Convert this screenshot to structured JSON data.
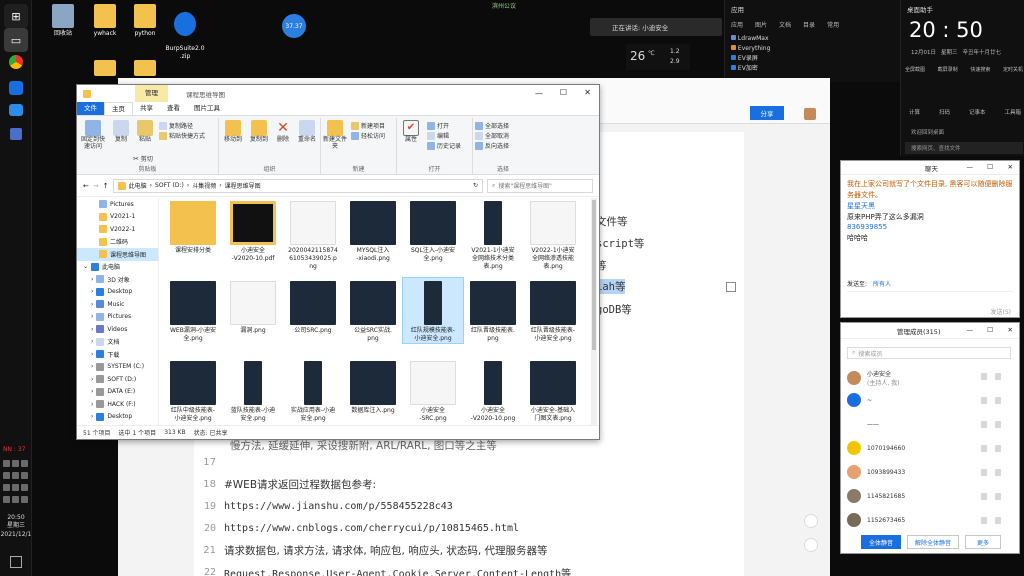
{
  "desktop": {
    "icons": [
      {
        "label": "回收站"
      },
      {
        "label": "ywhack"
      },
      {
        "label": "python"
      },
      {
        "label": "BurpSuite2.0\n.zip"
      }
    ],
    "badge_fps": "37.37"
  },
  "top_center": {
    "signal": "滨州公议"
  },
  "live": {
    "text": "正在讲话: 小迪安全"
  },
  "net_widget": {
    "temp": "26",
    "unit": "℃",
    "up": "1.2",
    "down": "2.9"
  },
  "apps_panel": {
    "title": "应用",
    "tabs": [
      "应用",
      "图片",
      "文档",
      "目录",
      "常用"
    ],
    "items": [
      "LdrawMax",
      "Everything",
      "EV录屏",
      "EV加密"
    ]
  },
  "clock": {
    "title": "桌面助手",
    "time": "20 : 50",
    "date": "12月01日",
    "weekday": "星期三",
    "lunar": "辛丑年十月廿七",
    "actions": [
      "全屏截图",
      "截屏录制",
      "快速搜索",
      "定时关机"
    ],
    "actions2": [
      "计算",
      "扫码",
      "记事本",
      "工具箱"
    ],
    "message": "欢迎回到桌面",
    "search_placeholder": "搜索网页、查找文件"
  },
  "editor": {
    "share_label": "分享",
    "lines": [
      {
        "n": "17",
        "text": ""
      },
      {
        "n": "18",
        "text": "#WEB请求返回过程数据包参考:"
      },
      {
        "n": "19",
        "text": "https://www.jianshu.com/p/558455228c43"
      },
      {
        "n": "20",
        "text": "https://www.cnblogs.com/cherrycui/p/10815465.html"
      },
      {
        "n": "21",
        "text": "请求数据包, 请求方法, 请求体, 响应包, 响应头, 状态码, 代理服务器等"
      },
      {
        "n": "22",
        "text": "Request,Response,User-Agent,Cookie,Server,Content-Length等"
      }
    ],
    "partials": [
      "文件等",
      "script等",
      "等",
      "iah等",
      "goDB等"
    ],
    "prev_line": "慢方法, 延缓延伸, 采设搜新附, ARL/RARL, 图口等之主等"
  },
  "explorer": {
    "title": "课程思维导图",
    "ribbon_tabs": [
      "文件",
      "主页",
      "共享",
      "查看",
      "图片工具"
    ],
    "context_tab": "管理",
    "ribbon": {
      "clipboard": {
        "pin": "固定到快速访问",
        "copy": "复制",
        "paste": "粘贴",
        "cut": "剪切",
        "copypath": "复制路径",
        "pasteshortcut": "粘贴快捷方式",
        "name": "剪贴板"
      },
      "organize": {
        "move": "移动到",
        "copyto": "复制到",
        "delete": "删除",
        "rename": "重命名",
        "name": "组织"
      },
      "new": {
        "folder": "新建文件夹",
        "item": "新建项目",
        "easy": "轻松访问",
        "name": "新建"
      },
      "open": {
        "props": "属性",
        "open": "打开",
        "edit": "编辑",
        "history": "历史记录",
        "name": "打开"
      },
      "select": {
        "all": "全部选择",
        "none": "全部取消",
        "invert": "反向选择",
        "name": "选择"
      }
    },
    "address": [
      "此电脑",
      "SOFT (D:)",
      "斗集视频",
      "课程思维导图"
    ],
    "search_placeholder": "搜索\"课程思维导图\"",
    "nav": [
      {
        "label": "Pictures",
        "sel": false
      },
      {
        "label": "V2021-1",
        "sel": false
      },
      {
        "label": "V2022-1",
        "sel": false
      },
      {
        "label": "二维码",
        "sel": false
      },
      {
        "label": "课程思维导图",
        "sel": true
      },
      {
        "label": "此电脑",
        "sel": false
      },
      {
        "label": "3D 对象",
        "sel": false
      },
      {
        "label": "Desktop",
        "sel": false
      },
      {
        "label": "Music",
        "sel": false
      },
      {
        "label": "Pictures",
        "sel": false
      },
      {
        "label": "Videos",
        "sel": false
      },
      {
        "label": "文档",
        "sel": false
      },
      {
        "label": "下载",
        "sel": false
      },
      {
        "label": "SYSTEM (C:)",
        "sel": false
      },
      {
        "label": "SOFT (D:)",
        "sel": false
      },
      {
        "label": "DATA (E:)",
        "sel": false
      },
      {
        "label": "HACK (F:)",
        "sel": false
      },
      {
        "label": "Desktop",
        "sel": false
      }
    ],
    "files": [
      {
        "name": "课程安排分类",
        "kind": "folder"
      },
      {
        "name": "小迪安全\n-V2020-10.pdf",
        "kind": "pdf"
      },
      {
        "name": "2020042115874\n61053439025.p\nng",
        "kind": "white"
      },
      {
        "name": "MYSQL注入\n-xiaodi.png",
        "kind": "dark"
      },
      {
        "name": "SQL注入-小迪安\n全.png",
        "kind": "dark"
      },
      {
        "name": "V2021-1小迪安\n全网络技术分类\n表.png",
        "kind": "tall"
      },
      {
        "name": "V2022-1小迪安\n全网络渗透技能\n表.png",
        "kind": "white"
      },
      {
        "name": "WEB漏洞-小迪安\n全.png",
        "kind": "dark"
      },
      {
        "name": "漏洞.png",
        "kind": "white"
      },
      {
        "name": "公司SRC.png",
        "kind": "dark"
      },
      {
        "name": "公益SRC实战.\npng",
        "kind": "dark"
      },
      {
        "name": "红队规模技能表-\n小迪安全.png",
        "kind": "tall",
        "sel": true
      },
      {
        "name": "红队晋级技能表.\npng",
        "kind": "dark"
      },
      {
        "name": "红队晋级技能表-\n小迪安全.png",
        "kind": "dark"
      },
      {
        "name": "红队中级技能表-\n小迪安全.png",
        "kind": "dark"
      },
      {
        "name": "蓝队技能表-小迪\n安全.png",
        "kind": "tall"
      },
      {
        "name": "实战应用表-小迪\n安全.png",
        "kind": "tall"
      },
      {
        "name": "数据库注入.png",
        "kind": "dark"
      },
      {
        "name": "小迪安全\n-SRC.png",
        "kind": "white"
      },
      {
        "name": "小迪安全\n-V2020-10.png",
        "kind": "tall"
      },
      {
        "name": "小迪安全-基础入\n门图文表.png",
        "kind": "dark"
      }
    ],
    "status": {
      "count": "51 个项目",
      "selected": "选中 1 个项目",
      "size": "313 KB",
      "state": "状态: 已共享"
    }
  },
  "chat": {
    "title": "聊天",
    "messages": [
      {
        "text": "我在上家公司就写了个文件目录, 黑客可以随便删除服务器文件。",
        "color": "#c85a00"
      },
      {
        "text": "星星天黑",
        "color": "#1a6fe0"
      },
      {
        "text": "原来PHP弄了这么多漏洞",
        "color": "#222"
      },
      {
        "text": "836939855",
        "color": "#1a6fe0"
      },
      {
        "text": "哈哈哈",
        "color": "#222"
      }
    ],
    "send_to_label": "发送至:",
    "send_to": "所有人",
    "send_hint": "发送(S)"
  },
  "members": {
    "title": "管理成员(315)",
    "search_placeholder": "搜索成员",
    "list": [
      {
        "name": "小迪安全",
        "sub": "(主持人, 我)",
        "color": "#c58a5a"
      },
      {
        "name": "~",
        "sub": "",
        "color": "#1a6fe0"
      },
      {
        "name": "——",
        "sub": "",
        "color": "#ffffff"
      },
      {
        "name": "1070194660",
        "sub": "",
        "color": "#f5c400"
      },
      {
        "name": "1093899433",
        "sub": "",
        "color": "#e8a070"
      },
      {
        "name": "1145821685",
        "sub": "",
        "color": "#8a7a6a"
      },
      {
        "name": "1152673465",
        "sub": "",
        "color": "#7a6a5a"
      }
    ],
    "btn_mute": "全体静音",
    "btn_unmute": "解除全体静音",
    "btn_more": "更多"
  },
  "sys": {
    "time": "20:50",
    "weekday": "星期三",
    "date": "2021/12/1",
    "battery": "37"
  },
  "colors": {
    "accent": "#1a6fe0",
    "selected": "#cce8ff"
  }
}
